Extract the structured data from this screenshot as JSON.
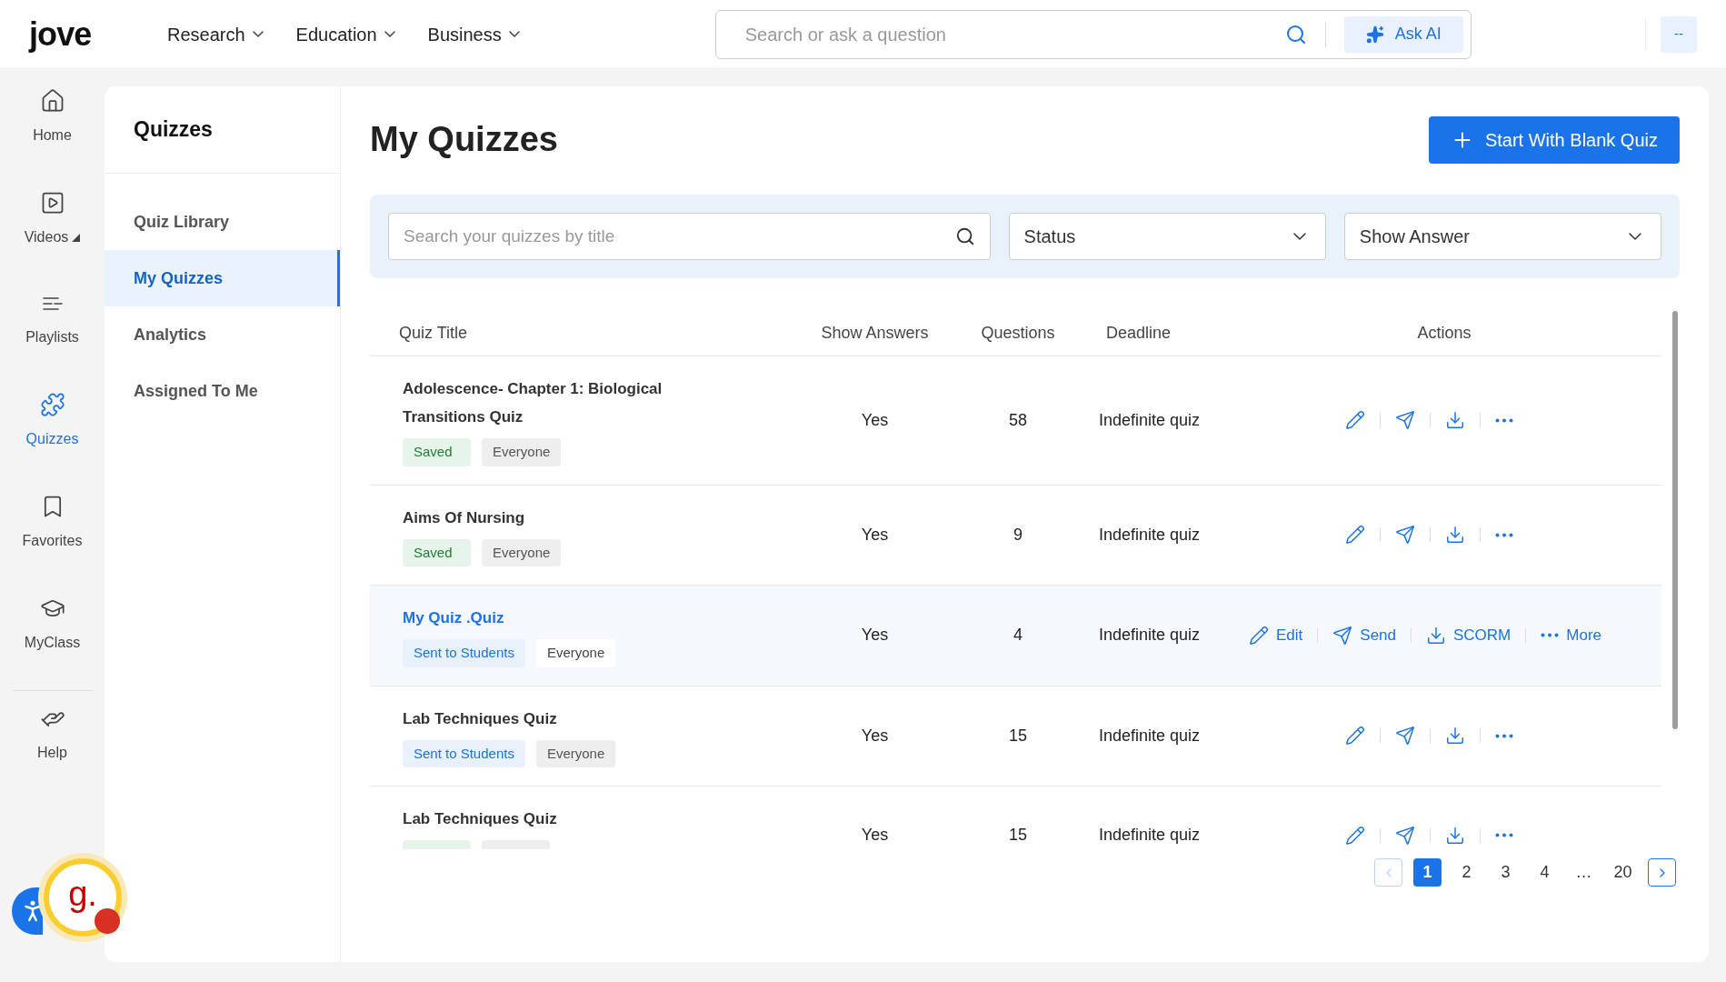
{
  "logo": "jove",
  "top_nav": [
    {
      "label": "Research"
    },
    {
      "label": "Education"
    },
    {
      "label": "Business"
    }
  ],
  "search": {
    "placeholder": "Search or ask a question",
    "ask_ai": "Ask AI"
  },
  "user_button": "--",
  "rail": [
    {
      "kind": "home",
      "label": "Home",
      "selected": false
    },
    {
      "kind": "videos",
      "label": "Videos",
      "selected": false,
      "caret": true
    },
    {
      "kind": "playlists",
      "label": "Playlists",
      "selected": false
    },
    {
      "kind": "quizzes",
      "label": "Quizzes",
      "selected": true
    },
    {
      "kind": "favorites",
      "label": "Favorites",
      "selected": false
    },
    {
      "kind": "myclass",
      "label": "MyClass",
      "selected": false
    },
    {
      "kind": "help",
      "label": "Help",
      "selected": false
    }
  ],
  "section": {
    "title": "Quizzes",
    "items": [
      {
        "label": "Quiz Library",
        "selected": false
      },
      {
        "label": "My Quizzes",
        "selected": true
      },
      {
        "label": "Analytics",
        "selected": false
      },
      {
        "label": "Assigned To Me",
        "selected": false
      }
    ]
  },
  "page": {
    "title": "My Quizzes",
    "new_button": "Start With Blank Quiz"
  },
  "filters": {
    "search_placeholder": "Search your quizzes by title",
    "dropdowns": [
      {
        "label": "Status"
      },
      {
        "label": "Show Answer"
      }
    ]
  },
  "table": {
    "columns": [
      "Quiz Title",
      "Show Answers",
      "Questions",
      "Deadline",
      "Actions"
    ],
    "rows": [
      {
        "title": "Adolescence- Chapter 1: Biological Transitions Quiz",
        "highlighted": false,
        "tags": [
          {
            "kind": "saved",
            "label": "Saved"
          },
          {
            "kind": "audience",
            "label": "Everyone"
          }
        ],
        "show_answers": "Yes",
        "questions": "58",
        "deadline": "Indefinite quiz",
        "actions": [
          {
            "kind": "edit"
          },
          {
            "kind": "send"
          },
          {
            "kind": "download"
          },
          {
            "kind": "more"
          }
        ]
      },
      {
        "title": "Aims Of Nursing",
        "highlighted": false,
        "tags": [
          {
            "kind": "saved",
            "label": "Saved"
          },
          {
            "kind": "audience",
            "label": "Everyone"
          }
        ],
        "show_answers": "Yes",
        "questions": "9",
        "deadline": "Indefinite quiz",
        "actions": [
          {
            "kind": "edit"
          },
          {
            "kind": "send"
          },
          {
            "kind": "download"
          },
          {
            "kind": "more"
          }
        ]
      },
      {
        "title": "My Quiz .Quiz",
        "highlighted": true,
        "tags": [
          {
            "kind": "sent",
            "label": "Sent to Students"
          },
          {
            "kind": "audience",
            "label": "Everyone"
          }
        ],
        "show_answers": "Yes",
        "questions": "4",
        "deadline": "Indefinite quiz",
        "actions": [
          {
            "kind": "edit",
            "label": "Edit"
          },
          {
            "kind": "send",
            "label": "Send"
          },
          {
            "kind": "download",
            "label": "SCORM"
          },
          {
            "kind": "more",
            "label": "More"
          }
        ]
      },
      {
        "title": "Lab Techniques Quiz",
        "highlighted": false,
        "tags": [
          {
            "kind": "sent",
            "label": "Sent to Students"
          },
          {
            "kind": "audience",
            "label": "Everyone"
          }
        ],
        "show_answers": "Yes",
        "questions": "15",
        "deadline": "Indefinite quiz",
        "actions": [
          {
            "kind": "edit"
          },
          {
            "kind": "send"
          },
          {
            "kind": "download"
          },
          {
            "kind": "more"
          }
        ]
      },
      {
        "title": "Lab Techniques Quiz",
        "highlighted": false,
        "tags": [
          {
            "kind": "saved"
          },
          {
            "kind": "audience"
          }
        ],
        "show_answers": "Yes",
        "questions": "15",
        "deadline": "Indefinite quiz",
        "actions": [
          {
            "kind": "edit"
          },
          {
            "kind": "send"
          },
          {
            "kind": "download"
          },
          {
            "kind": "more"
          }
        ]
      }
    ]
  },
  "pagination": {
    "pages": [
      {
        "label": "1",
        "selected": true
      },
      {
        "label": "2",
        "selected": false
      },
      {
        "label": "3",
        "selected": false
      },
      {
        "label": "4",
        "selected": false
      },
      {
        "label": "…",
        "selected": false
      },
      {
        "label": "20",
        "selected": false
      }
    ],
    "prev_disabled": true,
    "next_disabled": false
  },
  "widget": {
    "logo": "g.",
    "notification": true
  }
}
